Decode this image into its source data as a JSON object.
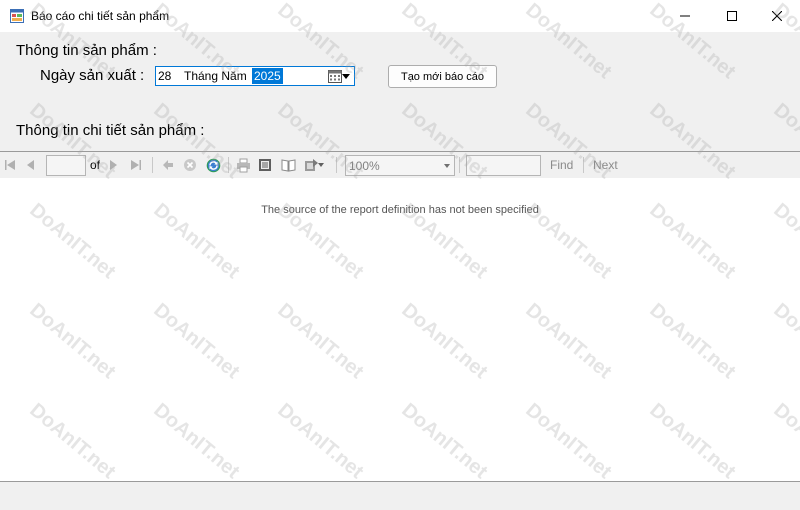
{
  "window": {
    "title": "Báo cáo chi tiết sản phẩm"
  },
  "form": {
    "product_info_label": "Thông tin sản phẩm :",
    "manufacture_date_label": "Ngày sản xuất :",
    "date_picker": {
      "day": "28",
      "month": "Tháng Năm",
      "year": "2025"
    },
    "new_report_button": "Tạo mới báo cáo",
    "product_detail_label": "Thông tin chi tiết sản phẩm :"
  },
  "report_viewer": {
    "toolbar": {
      "page_value": "",
      "of_label": "of",
      "zoom_value": "100%",
      "find_value": "",
      "find_label": "Find",
      "next_label": "Next"
    },
    "message": "The source of the report definition has not been specified"
  },
  "watermark": {
    "text": "DoAnIT.net"
  },
  "colors": {
    "accent": "#0078d7",
    "background": "#f0f0f0"
  }
}
